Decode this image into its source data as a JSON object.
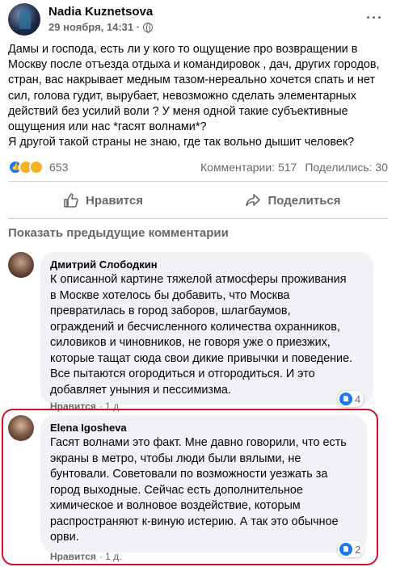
{
  "post": {
    "author": "Nadia Kuznetsova",
    "date": "29 ноября, 14:31 ·",
    "more_label": "···",
    "text_lines": [
      "Дамы и господа, есть ли у кого то ощущение про возвращении в",
      "Москву после отъезда отдыха и командировок , дач, других городов,",
      "стран, вас накрывает  медным тазом-нереально хочется спать и нет",
      "сил, голова гудит, вырубает, невозможно сделать элементарных",
      "действий без усилий воли ? У меня одной такие субъективные",
      "ощущения или нас *гасят волнами*?",
      "Я другой такой страны не знаю, где так вольно дышит человек?"
    ],
    "reactions_count": "653",
    "comments_count": "Комментарии: 517",
    "shares_count": "Поделились: 30",
    "like_label": "Нравится",
    "share_label": "Поделиться",
    "show_previous": "Показать предыдущие комментарии"
  },
  "comments": [
    {
      "author": "Дмитрий Слободкин",
      "text_lines": [
        "К описанной картине тяжелой атмосферы проживания",
        "в Москве хотелось бы добавить, что Москва",
        "превратилась в город заборов, шлагбаумов,",
        "ограждений и бесчисленного количества охранников,",
        "силовиков и чиновников, не говоря уже о приезжих,",
        "которые тащат сюда свои дикие привычки и поведение.",
        "Все пытаются огородиться и отгородиться. И это",
        "добавляет уныния и пессимизма."
      ],
      "like_label": "Нравится",
      "time": "· 1 д.",
      "reaction_count": "4"
    },
    {
      "author": "Elena Igosheva",
      "text_lines": [
        "Гасят волнами это факт. Мне давно говорили, что есть",
        "экраны в метро, чтобы люди были вялыми, не",
        "бунтовали. Советовали по возможности уезжать за",
        "город выходные. Сейчас есть дополнительное",
        "химическое и волновое воздействие, которым",
        "распространяют к-виную истерию. А так это обычное",
        "орви."
      ],
      "like_label": "Нравится",
      "time": "· 1 д.",
      "reaction_count": "2"
    }
  ],
  "colors": {
    "highlight": "#d10f2b",
    "like_blue": "#1877f2",
    "bubble_bg": "#f0f2f5",
    "muted_text": "#65676b"
  },
  "icons": [
    "globe-icon",
    "more-icon",
    "like-icon",
    "share-icon",
    "love-reaction-icon",
    "care-reaction-icon"
  ]
}
